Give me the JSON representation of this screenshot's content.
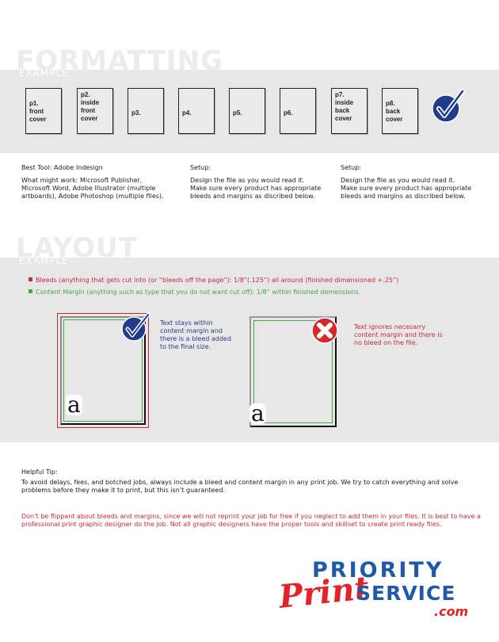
{
  "formatting": {
    "heading": "FORMATTING",
    "subheading": "EXAMPLE",
    "pages": [
      {
        "lines": [
          "p1.",
          "front",
          "cover"
        ]
      },
      {
        "lines": [
          "p2.",
          "inside",
          "front",
          "cover"
        ]
      },
      {
        "lines": [
          "p3."
        ]
      },
      {
        "lines": [
          "p4."
        ]
      },
      {
        "lines": [
          "p5."
        ]
      },
      {
        "lines": [
          "p6."
        ]
      },
      {
        "lines": [
          "p7.",
          "inside",
          "back",
          "cover"
        ]
      },
      {
        "lines": [
          "p8.",
          "back",
          "cover"
        ]
      }
    ],
    "badge": "check-icon"
  },
  "columns": [
    {
      "label": "Best Tool: Adobe Indesign",
      "text": "What might work: Microsoft Publisher,\nMicrosoft Word, Adobe Illustrator (multiple\nartboards), Adobe Photoshop (multiple files)."
    },
    {
      "label": "Setup:",
      "text": "Design the file as you would read it.\nMake sure every product has appropriate\nbleeds and margins as discribed below."
    },
    {
      "label": "Setup:",
      "text": "Design the file as you would read it.\nMake sure every product has appropriate\nbleeds and margins as discribed below."
    }
  ],
  "layout": {
    "heading": "LAYOUT",
    "subheading": "EXAMPLE",
    "bleed_line": "Bleeds (anything that gets cut into (or “bleeds off the page”): 1/8”(.125”) all around (finished dimensioned +.25”)",
    "margin_line": "Content Margin (anything such as type that you do not want cut off): 1/8” within finished demensions.",
    "good": {
      "letter": "a",
      "note": "Text stays within\ncontent margin and\nthere is a bleed added\nto the final size.",
      "badge": "check-icon"
    },
    "bad": {
      "letter": "a",
      "note": "Text ignores necesarry\ncontent margin and there is\nno bleed on the file.",
      "badge": "x-icon"
    },
    "colors": {
      "bleed": "#c8283a",
      "margin": "#4aa34f",
      "good_note": "#2b3a86"
    }
  },
  "tip": {
    "label": "Helpful Tip:",
    "text": "To avoid delays, fees, and botched jobs, always include a bleed and content margin in any print job. We try to catch everything and solve problems before they make it to print, but this isn’t guaranteed.",
    "warning": "Don’t be flippant about bleeds and margins, since we will not reprint your job for free if you neglect to add them in your files. It is best to have a professional print graphic designer do the job. Not all graphic designers have the proper tools and skillset to create print ready files."
  },
  "logo": {
    "line1": "PRIORITY",
    "line2": "Print",
    "line3": "SERVICE",
    "line4": ".com",
    "colors": {
      "blue": "#1e5aa8",
      "red": "#e4222a"
    }
  }
}
